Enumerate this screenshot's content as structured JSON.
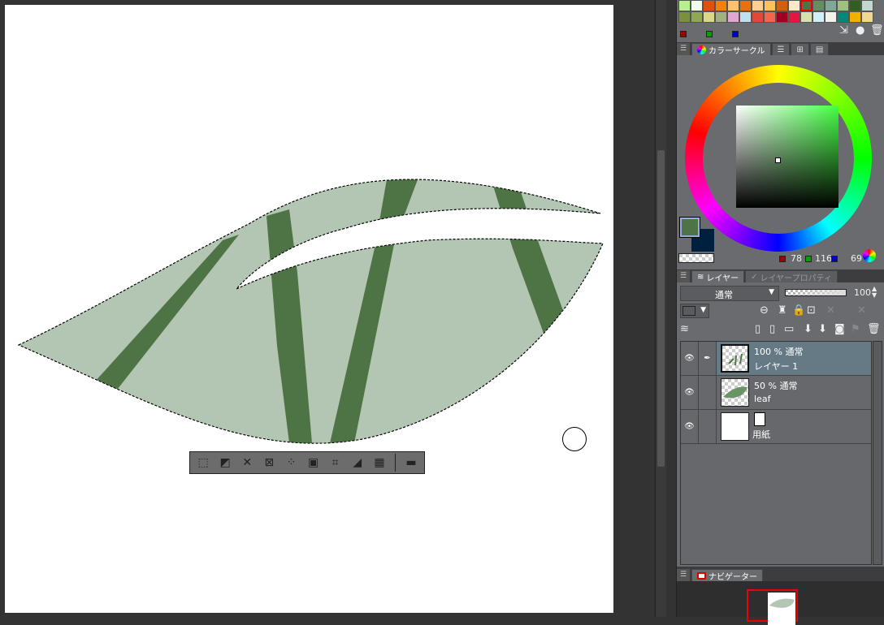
{
  "palette": {
    "colors": [
      "#b8f090",
      "#f0fce8",
      "#e05010",
      "#f08010",
      "#ffc070",
      "#e87010",
      "#ffd090",
      "#ffc060",
      "#d06010",
      "#ffe8c8",
      "#4e7445",
      "#609060",
      "#80a898",
      "#a0c080",
      "#306020",
      "#c0d8d0",
      "#7a9040",
      "#90a850",
      "#d8d888",
      "#a0b080",
      "#e0a8d0",
      "#c0e0f0",
      "#e04838",
      "#f06848",
      "#a00020",
      "#e01840",
      "#d8e0b0",
      "#d0f0f8",
      "#f4f0ec",
      "#008878",
      "#f0b000",
      "#f0d890"
    ],
    "selected_index": 10
  },
  "color_circle": {
    "tab_label": "カラーサークル",
    "main_color": "#4e7445",
    "sub_color": "#00203f",
    "r": "78",
    "g": "116",
    "b": "69"
  },
  "layers_panel": {
    "tab_label": "レイヤー",
    "tab_properties_label": "レイヤープロパティ",
    "blend_mode": "通常",
    "opacity": "100",
    "layers": [
      {
        "opacity_mode": "100 % 通常",
        "name": "レイヤー 1",
        "active": true
      },
      {
        "opacity_mode": "50 % 通常",
        "name": "leaf",
        "active": false
      },
      {
        "opacity_mode": "",
        "name": "用紙",
        "active": false
      }
    ]
  },
  "navigator": {
    "tab_label": "ナビゲーター"
  },
  "selection_toolbar": {
    "icons": [
      "deselect-icon",
      "invert-selection-icon",
      "expand-selection-icon",
      "shrink-selection-icon",
      "scale-selection-icon",
      "transform-icon",
      "scale-up-icon",
      "fill-icon",
      "clear-outside-icon",
      "settings-icon"
    ]
  },
  "artwork": {
    "leaf_fill": "#b3c6b3",
    "stripe_color": "#4e7445"
  }
}
